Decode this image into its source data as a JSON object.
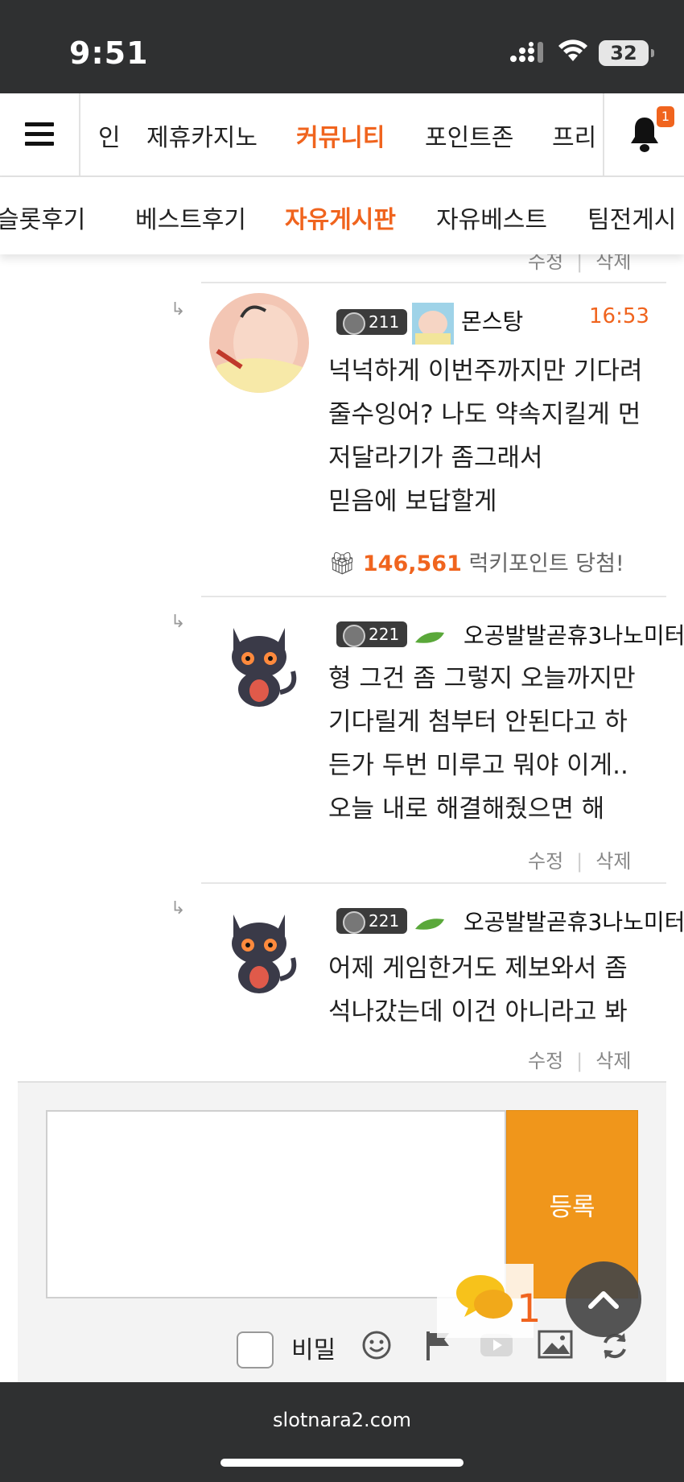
{
  "status_bar": {
    "time": "9:51",
    "battery": "32"
  },
  "main_nav": {
    "tabs": [
      {
        "label": "인"
      },
      {
        "label": "제휴카지노"
      },
      {
        "label": "커뮤니티",
        "active": true
      },
      {
        "label": "포인트존"
      },
      {
        "label": "프리"
      }
    ],
    "notification_count": "1"
  },
  "sub_nav": {
    "tabs": [
      {
        "label": "슬롯후기"
      },
      {
        "label": "베스트후기"
      },
      {
        "label": "자유게시판",
        "active": true
      },
      {
        "label": "자유베스트"
      },
      {
        "label": "팀전게시"
      }
    ]
  },
  "prev_actions": {
    "edit": "수정",
    "delete": "삭제"
  },
  "comments": [
    {
      "level": "211",
      "author": "몬스탕",
      "time": "16:53",
      "lines": [
        "넉넉하게 이번주까지만 기다려",
        "줄수잉어? 나도 약속지킬게 먼",
        "저달라기가 좀그래서",
        "믿음에 보답할게"
      ],
      "prize_amount": "146,561",
      "prize_text": "럭키포인트 당첨!"
    },
    {
      "level": "221",
      "author": "오공발발곧휴3나노미터",
      "lines": [
        "형 그건 좀 그렇지 오늘까지만",
        "기다릴게 첨부터 안된다고 하",
        "든가 두번 미루고 뭐야 이게..",
        "오늘 내로 해결해줬으면 해"
      ],
      "edit": "수정",
      "delete": "삭제"
    },
    {
      "level": "221",
      "author": "오공발발곧휴3나노미터",
      "lines": [
        "어제 게임한거도 제보와서 좀",
        "석나갔는데 이건 아니라고 봐"
      ],
      "edit": "수정",
      "delete": "삭제"
    }
  ],
  "write": {
    "submit_label": "등록",
    "secret_label": "비밀",
    "icons": [
      "emoji-icon",
      "flag-icon",
      "youtube-icon",
      "image-icon",
      "refresh-icon"
    ]
  },
  "floating": {
    "chat_count": "1"
  },
  "bottom_bar": {
    "url": "slotnara2.com"
  },
  "colors": {
    "accent": "#f0641e",
    "submit": "#f0961b",
    "dark": "#2f3031"
  }
}
